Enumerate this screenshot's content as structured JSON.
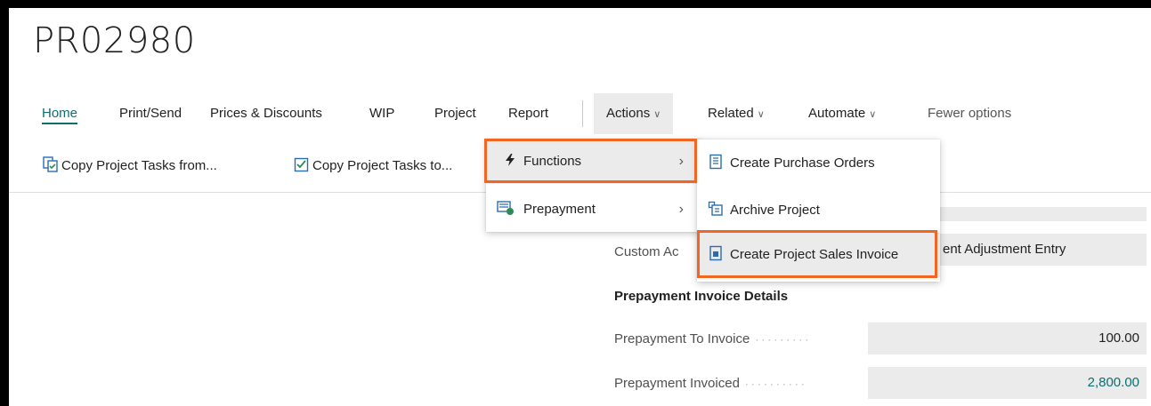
{
  "page": {
    "title": "PR02980"
  },
  "actionbar": {
    "tabs": [
      {
        "label": "Home"
      },
      {
        "label": "Print/Send"
      },
      {
        "label": "Prices & Discounts"
      },
      {
        "label": "WIP"
      },
      {
        "label": "Project"
      },
      {
        "label": "Report"
      }
    ],
    "dropdowns": [
      {
        "label": "Actions"
      },
      {
        "label": "Related"
      },
      {
        "label": "Automate"
      }
    ],
    "fewer_options": "Fewer options"
  },
  "toolbar": {
    "copy_from": "Copy Project Tasks from...",
    "copy_to": "Copy Project Tasks to..."
  },
  "actions_menu": {
    "items": [
      {
        "label": "Functions",
        "icon": "lightning-icon"
      },
      {
        "label": "Prepayment",
        "icon": "prepayment-icon"
      }
    ]
  },
  "functions_submenu": {
    "items": [
      {
        "label": "Create Purchase Orders",
        "icon": "document-icon"
      },
      {
        "label": "Archive Project",
        "icon": "archive-icon"
      },
      {
        "label": "Create Project Sales Invoice",
        "icon": "invoice-icon"
      }
    ]
  },
  "content": {
    "custom_label": "Custom Ac",
    "adjustment_value": "ent Adjustment Entry",
    "section_title": "Prepayment Invoice Details",
    "fields": [
      {
        "label": "Prepayment To Invoice",
        "value": "100.00"
      },
      {
        "label": "Prepayment Invoiced",
        "value": "2,800.00"
      }
    ]
  },
  "colors": {
    "accent": "#0d6e6e",
    "callout": "#f26522"
  }
}
